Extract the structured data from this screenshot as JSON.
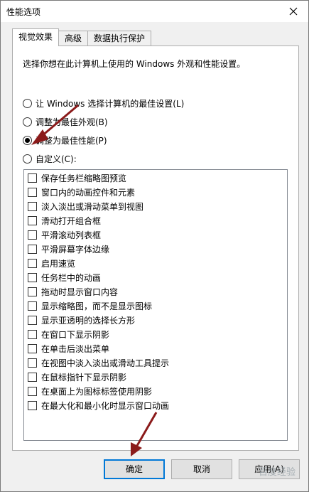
{
  "window": {
    "title": "性能选项"
  },
  "tabs": [
    {
      "label": "视觉效果",
      "active": true
    },
    {
      "label": "高级",
      "active": false
    },
    {
      "label": "数据执行保护",
      "active": false
    }
  ],
  "description": "选择你想在此计算机上使用的 Windows 外观和性能设置。",
  "radios": [
    {
      "label": "让 Windows 选择计算机的最佳设置(L)",
      "checked": false
    },
    {
      "label": "调整为最佳外观(B)",
      "checked": false
    },
    {
      "label": "调整为最佳性能(P)",
      "checked": true
    },
    {
      "label": "自定义(C):",
      "checked": false
    }
  ],
  "effects": [
    {
      "label": "保存任务栏缩略图预览",
      "checked": false
    },
    {
      "label": "窗口内的动画控件和元素",
      "checked": false
    },
    {
      "label": "淡入淡出或滑动菜单到视图",
      "checked": false
    },
    {
      "label": "滑动打开组合框",
      "checked": false
    },
    {
      "label": "平滑滚动列表框",
      "checked": false
    },
    {
      "label": "平滑屏幕字体边缘",
      "checked": false
    },
    {
      "label": "启用速览",
      "checked": false
    },
    {
      "label": "任务栏中的动画",
      "checked": false
    },
    {
      "label": "拖动时显示窗口内容",
      "checked": false
    },
    {
      "label": "显示缩略图，而不是显示图标",
      "checked": false
    },
    {
      "label": "显示亚透明的选择长方形",
      "checked": false
    },
    {
      "label": "在窗口下显示阴影",
      "checked": false
    },
    {
      "label": "在单击后淡出菜单",
      "checked": false
    },
    {
      "label": "在视图中淡入淡出或滑动工具提示",
      "checked": false
    },
    {
      "label": "在鼠标指针下显示阴影",
      "checked": false
    },
    {
      "label": "在桌面上为图标标签使用阴影",
      "checked": false
    },
    {
      "label": "在最大化和最小化时显示窗口动画",
      "checked": false
    }
  ],
  "buttons": {
    "ok": "确定",
    "cancel": "取消",
    "apply": "应用(A)"
  },
  "watermark": "百度经验",
  "colors": {
    "accent": "#0078d7",
    "arrow": "#8b1a1a"
  }
}
